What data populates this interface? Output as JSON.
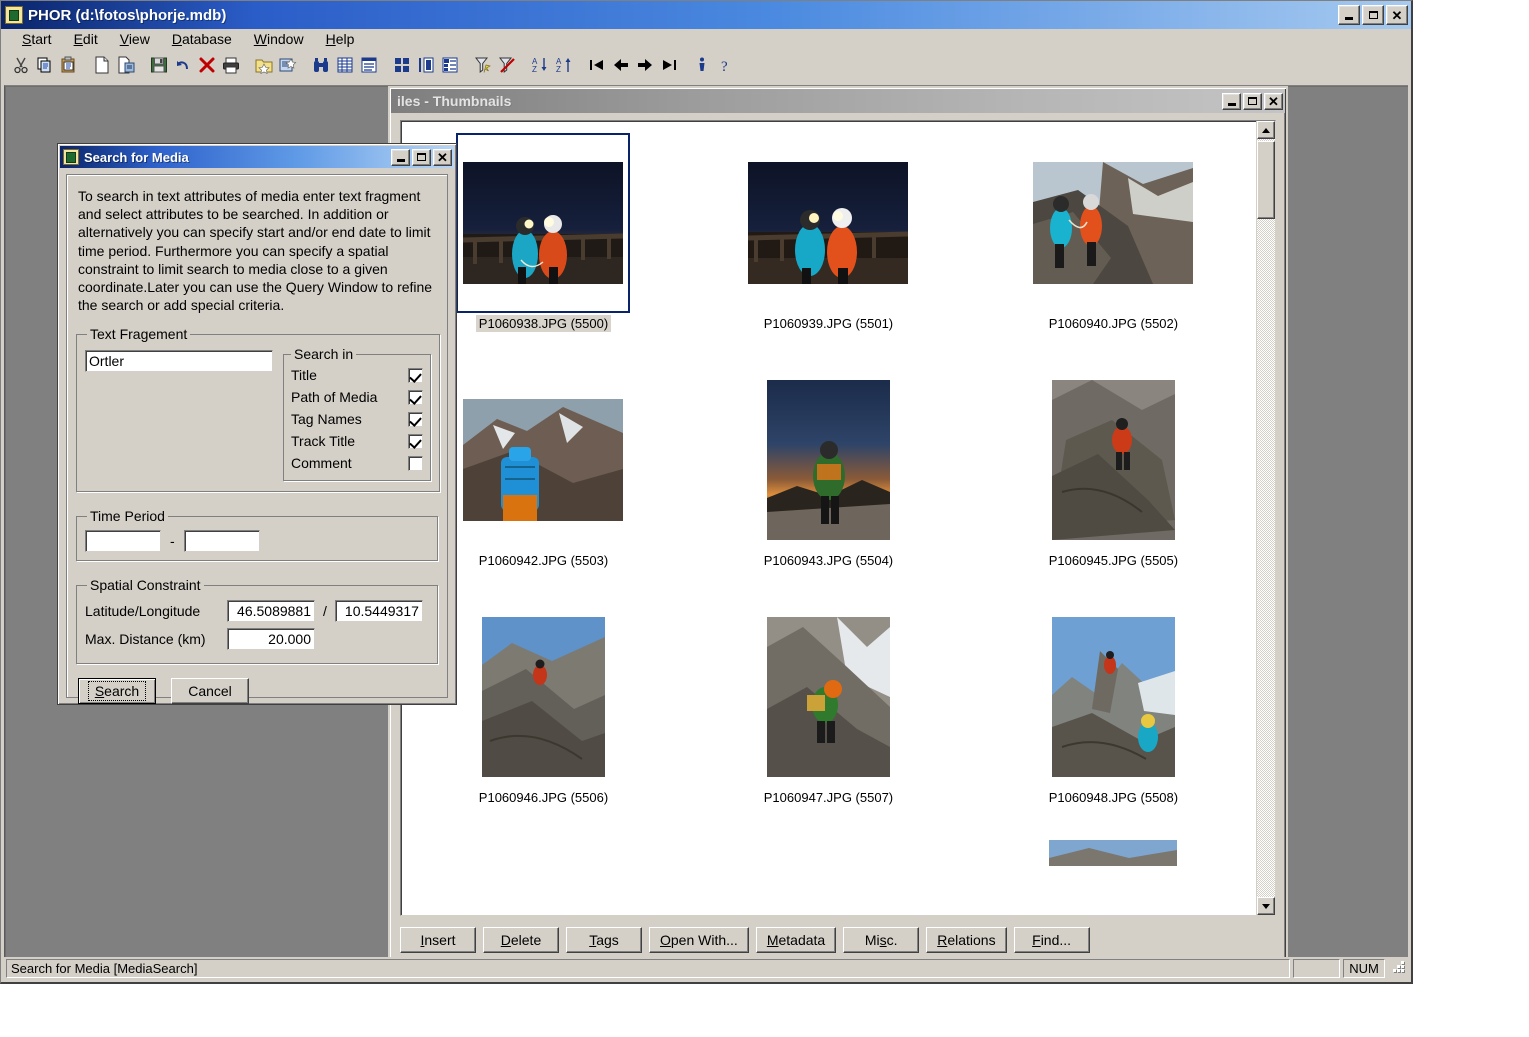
{
  "app": {
    "title": "PHOR (d:\\fotos\\phorje.mdb)",
    "icon": "app-database-icon",
    "window_buttons": {
      "minimize": "_",
      "maximize": "□",
      "close": "✕"
    }
  },
  "menu": {
    "items": [
      {
        "label": "Start",
        "mnemonic": "S"
      },
      {
        "label": "Edit",
        "mnemonic": "E"
      },
      {
        "label": "View",
        "mnemonic": "V"
      },
      {
        "label": "Database",
        "mnemonic": "D"
      },
      {
        "label": "Window",
        "mnemonic": "W"
      },
      {
        "label": "Help",
        "mnemonic": "H"
      }
    ]
  },
  "toolbar": {
    "buttons": [
      {
        "name": "cut-icon",
        "tip": "Cut"
      },
      {
        "name": "copy-icon",
        "tip": "Copy"
      },
      {
        "name": "paste-icon",
        "tip": "Paste"
      },
      {
        "name": "new-document-icon",
        "tip": "New"
      },
      {
        "name": "open-document-icon",
        "tip": "Open"
      },
      {
        "name": "save-icon",
        "tip": "Save"
      },
      {
        "name": "undo-icon",
        "tip": "Undo"
      },
      {
        "name": "delete-icon",
        "tip": "Delete"
      },
      {
        "name": "print-icon",
        "tip": "Print"
      },
      {
        "name": "new-folder-icon",
        "tip": "New Folder"
      },
      {
        "name": "add-media-icon",
        "tip": "Add Media"
      },
      {
        "name": "find-binoculars-icon",
        "tip": "Find"
      },
      {
        "name": "list-view-icon",
        "tip": "List View"
      },
      {
        "name": "detail-view-icon",
        "tip": "Detail View"
      },
      {
        "name": "thumbnail-view-icon",
        "tip": "Thumbnails"
      },
      {
        "name": "split-view-icon",
        "tip": "Split View"
      },
      {
        "name": "tree-view-icon",
        "tip": "Tree View"
      },
      {
        "name": "filter-apply-icon",
        "tip": "Apply Filter"
      },
      {
        "name": "filter-remove-icon",
        "tip": "Remove Filter"
      },
      {
        "name": "sort-ascending-icon",
        "tip": "Sort Ascending"
      },
      {
        "name": "sort-descending-icon",
        "tip": "Sort Descending"
      },
      {
        "name": "nav-first-icon",
        "tip": "First"
      },
      {
        "name": "nav-previous-icon",
        "tip": "Previous"
      },
      {
        "name": "nav-next-icon",
        "tip": "Next"
      },
      {
        "name": "nav-last-icon",
        "tip": "Last"
      },
      {
        "name": "info-icon",
        "tip": "Info"
      },
      {
        "name": "help-icon",
        "tip": "Help"
      }
    ]
  },
  "thumbnails_window": {
    "title": "iles - Thumbnails",
    "window_buttons": {
      "minimize": "_",
      "maximize": "□",
      "close": "✕"
    },
    "items": [
      {
        "label": "P1060938.JPG (5500)",
        "selected": true,
        "orientation": "landscape"
      },
      {
        "label": "P1060939.JPG (5501)",
        "selected": false,
        "orientation": "landscape"
      },
      {
        "label": "P1060940.JPG (5502)",
        "selected": false,
        "orientation": "landscape"
      },
      {
        "label": "P1060942.JPG (5503)",
        "selected": false,
        "orientation": "landscape"
      },
      {
        "label": "P1060943.JPG (5504)",
        "selected": false,
        "orientation": "portrait"
      },
      {
        "label": "P1060945.JPG (5505)",
        "selected": false,
        "orientation": "portrait"
      },
      {
        "label": "P1060946.JPG (5506)",
        "selected": false,
        "orientation": "portrait"
      },
      {
        "label": "P1060947.JPG (5507)",
        "selected": false,
        "orientation": "portrait"
      },
      {
        "label": "P1060948.JPG (5508)",
        "selected": false,
        "orientation": "portrait"
      }
    ],
    "buttons": [
      {
        "label": "Insert",
        "mnemonic": "I"
      },
      {
        "label": "Delete",
        "mnemonic": "D"
      },
      {
        "label": "Tags",
        "mnemonic": "T"
      },
      {
        "label": "Open With...",
        "mnemonic": "O"
      },
      {
        "label": "Metadata",
        "mnemonic": "M"
      },
      {
        "label": "Misc.",
        "mnemonic": "s"
      },
      {
        "label": "Relations",
        "mnemonic": "R"
      },
      {
        "label": "Find...",
        "mnemonic": "F"
      }
    ]
  },
  "dialog": {
    "title": "Search for Media",
    "icon": "app-database-icon",
    "window_buttons": {
      "minimize": "_",
      "maximize": "□",
      "close": "✕"
    },
    "description": "To search in text attributes of media enter text fragment and select attributes to be searched. In addition or alternatively you can specify start and/or end date to limit time period. Furthermore you can specify a spatial constraint to limit search to media close to a given coordinate.Later you can use the Query Window to refine the search or add special criteria.",
    "text_fragment": {
      "legend": "Text Fragement",
      "value": "Ortler",
      "search_in": {
        "legend": "Search in",
        "options": [
          {
            "label": "Title",
            "checked": true
          },
          {
            "label": "Path of Media",
            "checked": true
          },
          {
            "label": "Tag Names",
            "checked": true
          },
          {
            "label": "Track Title",
            "checked": true
          },
          {
            "label": "Comment",
            "checked": false
          }
        ]
      }
    },
    "time_period": {
      "legend": "Time Period",
      "from": "",
      "to": "",
      "separator": "-"
    },
    "spatial_constraint": {
      "legend": "Spatial Constraint",
      "latlon_label": "Latitude/Longitude",
      "latitude": "46.5089881",
      "longitude": "10.5449317",
      "separator": "/",
      "distance_label": "Max. Distance (km)",
      "distance": "20.000"
    },
    "buttons": {
      "search": "Search",
      "search_mnemonic": "S",
      "cancel": "Cancel"
    }
  },
  "statusbar": {
    "message": "Search for Media [MediaSearch]",
    "pane_small": "",
    "num_indicator": "NUM"
  },
  "colors": {
    "window_face": "#d4d0c8",
    "mdi_background": "#808080",
    "active_title": "#0a246a",
    "inactive_title": "#808080",
    "selection": "#0a246a"
  }
}
